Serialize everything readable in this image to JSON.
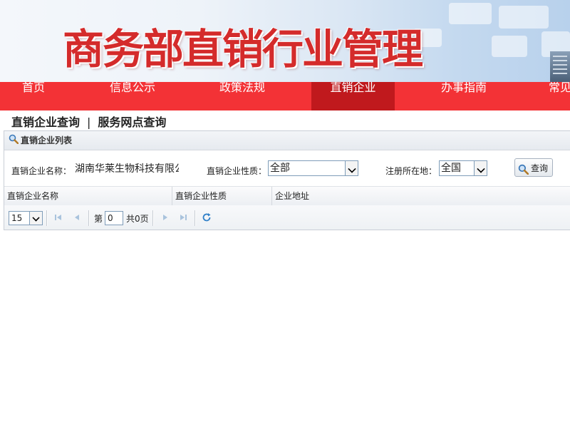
{
  "banner": {
    "title": "商务部直销行业管理"
  },
  "nav": {
    "items": [
      {
        "label": "首页"
      },
      {
        "label": "信息公示"
      },
      {
        "label": "政策法规"
      },
      {
        "label": "直销企业"
      },
      {
        "label": "办事指南"
      },
      {
        "label": "常见"
      }
    ],
    "active_index": 3
  },
  "subtabs": {
    "company_query": "直销企业查询",
    "separator": "|",
    "service_query": "服务网点查询"
  },
  "panel": {
    "title": "直销企业列表",
    "form": {
      "name_label": "直销企业名称：",
      "name_value": "湖南华莱生物科技有限公",
      "type_label": "直销企业性质：",
      "type_value": "全部",
      "region_label": "注册所在地：",
      "region_value": "全国",
      "query_label": "查询"
    },
    "columns": [
      "直销企业名称",
      "直销企业性质",
      "企业地址"
    ],
    "pager": {
      "page_size": "15",
      "page_prefix": "第",
      "page_value": "0",
      "total_text": "共0页"
    }
  },
  "colors": {
    "nav_bg": "#f33236",
    "nav_active": "#c0191d",
    "title_red": "#d42b2b"
  }
}
